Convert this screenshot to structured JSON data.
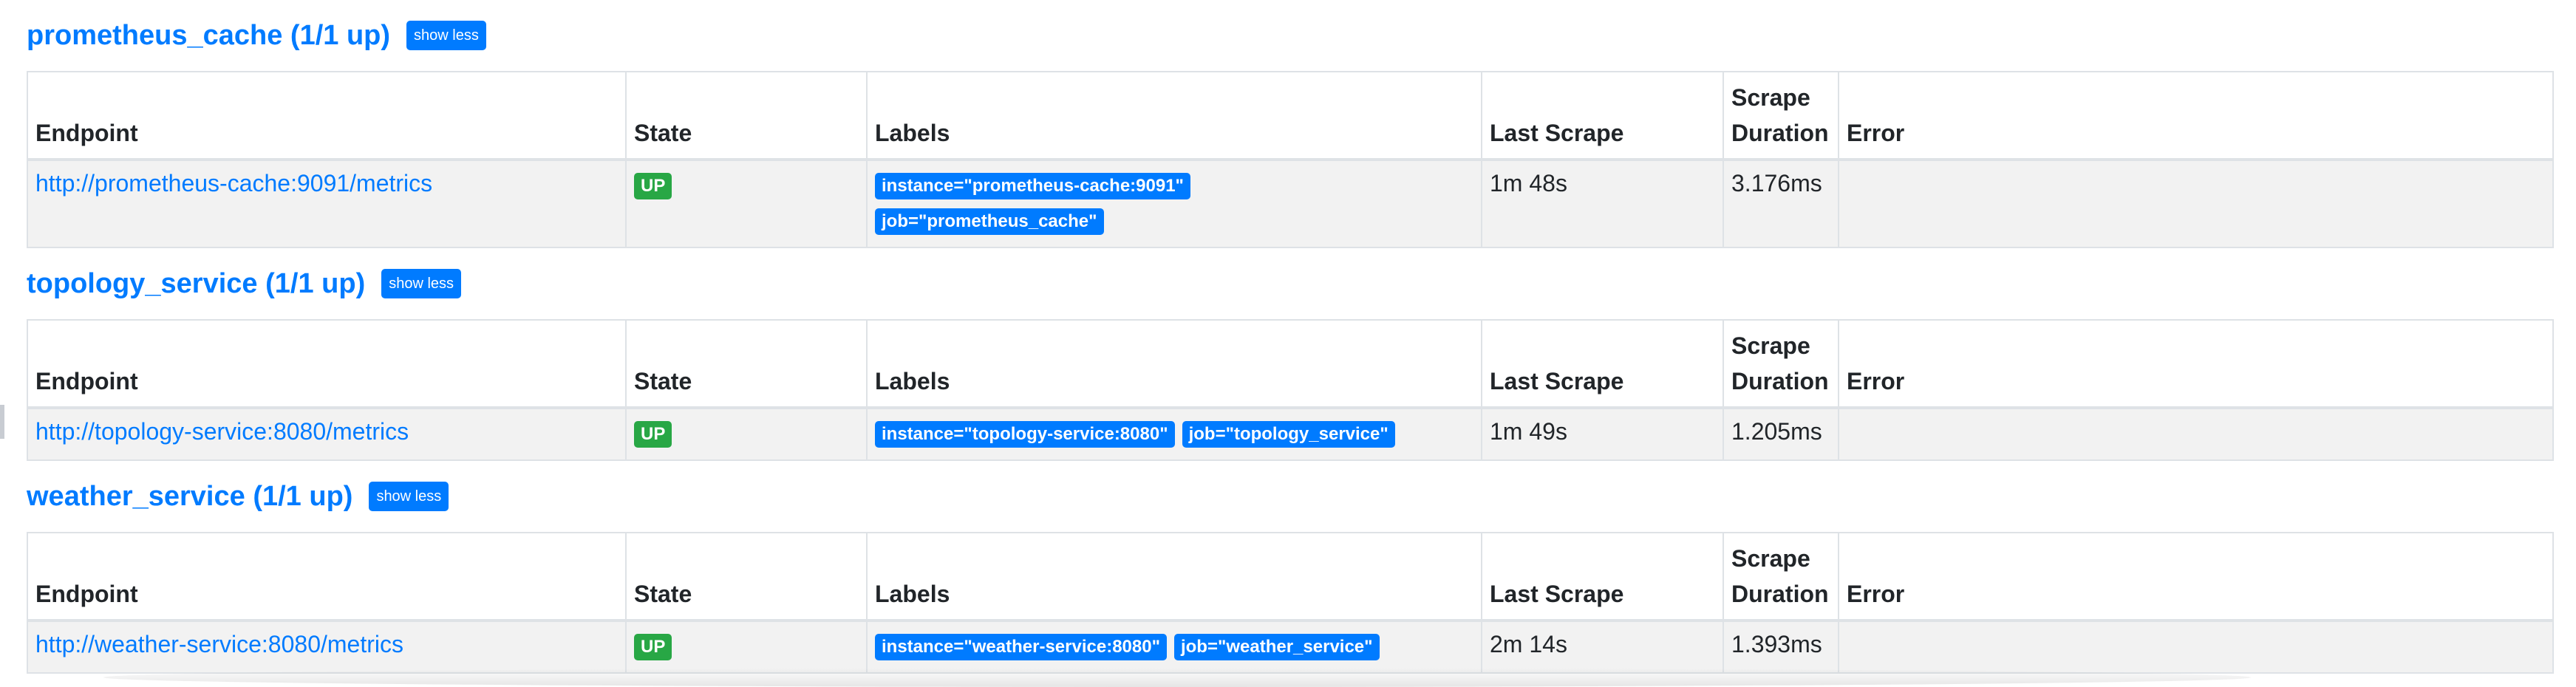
{
  "columns": {
    "endpoint": "Endpoint",
    "state": "State",
    "labels": "Labels",
    "last_scrape": "Last Scrape",
    "scrape_duration_1": "Scrape",
    "scrape_duration_2": "Duration",
    "error": "Error"
  },
  "pools": [
    {
      "title": "prometheus_cache (1/1 up)",
      "button": "show less",
      "target": {
        "endpoint": "http://prometheus-cache:9091/metrics",
        "state": "UP",
        "labels": [
          "instance=\"prometheus-cache:9091\"",
          "job=\"prometheus_cache\""
        ],
        "last_scrape": "1m 48s",
        "scrape_duration": "3.176ms",
        "error": ""
      }
    },
    {
      "title": "topology_service (1/1 up)",
      "button": "show less",
      "target": {
        "endpoint": "http://topology-service:8080/metrics",
        "state": "UP",
        "labels": [
          "instance=\"topology-service:8080\"",
          "job=\"topology_service\""
        ],
        "last_scrape": "1m 49s",
        "scrape_duration": "1.205ms",
        "error": ""
      }
    },
    {
      "title": "weather_service (1/1 up)",
      "button": "show less",
      "target": {
        "endpoint": "http://weather-service:8080/metrics",
        "state": "UP",
        "labels": [
          "instance=\"weather-service:8080\"",
          "job=\"weather_service\""
        ],
        "last_scrape": "2m 14s",
        "scrape_duration": "1.393ms",
        "error": ""
      }
    }
  ],
  "colors": {
    "link": "#007bff",
    "up_badge": "#28a745",
    "label_badge": "#007bff"
  }
}
